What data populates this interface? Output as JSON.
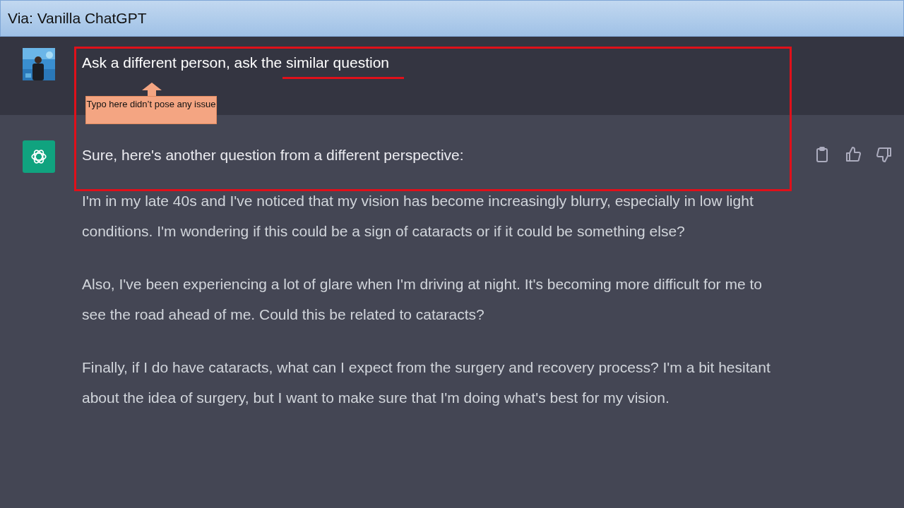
{
  "header": {
    "title": "Via: Vanilla ChatGPT"
  },
  "user_message": {
    "text": "Ask a different person, ask the similar question"
  },
  "annotation": {
    "callout": "Typo here didn’t pose any issue"
  },
  "assistant_message": {
    "intro": "Sure, here's another question from a different perspective:",
    "paragraphs": [
      "I'm in my late 40s and I've noticed that my vision has become increasingly blurry, especially in low light conditions. I'm wondering if this could be a sign of cataracts or if it could be something else?",
      "Also, I've been experiencing a lot of glare when I'm driving at night. It's becoming more difficult for me to see the road ahead of me. Could this be related to cataracts?",
      "Finally, if I do have cataracts, what can I expect from the surgery and recovery process? I'm a bit hesitant about the idea of surgery, but I want to make sure that I'm doing what's best for my vision."
    ]
  }
}
